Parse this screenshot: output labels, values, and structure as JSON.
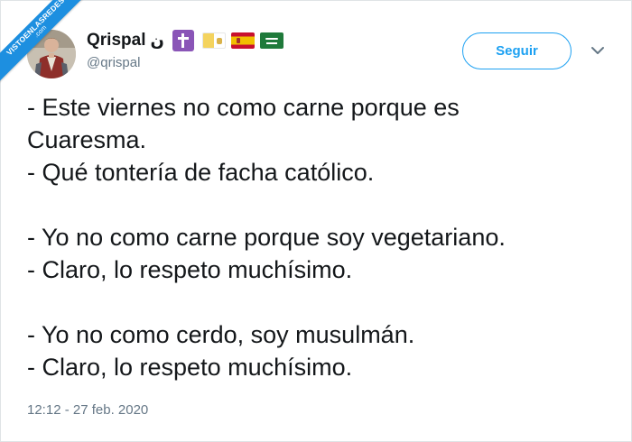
{
  "watermark": {
    "line1": "VISTOENLASREDES",
    "line2": ".com"
  },
  "author": {
    "display_name": "Qrispal",
    "name_glyph": "ن",
    "emoji": [
      "latin-cross-emoji",
      "vatican-flag-emoji",
      "spain-flag-emoji",
      "saudi-arabia-flag-emoji"
    ],
    "handle": "@qrispal"
  },
  "follow_button": {
    "label": "Seguir"
  },
  "tweet": {
    "lines": [
      "- Este viernes no como carne porque es",
      "Cuaresma.",
      "- Qué tontería de facha católico.",
      "",
      "- Yo no como carne porque soy vegetariano.",
      "- Claro, lo respeto muchísimo.",
      "",
      "- Yo no como cerdo, soy musulmán.",
      "- Claro, lo respeto muchísimo."
    ],
    "timestamp": "12:12 - 27 feb. 2020"
  },
  "colors": {
    "accent": "#1da1f2",
    "text_primary": "#14171a",
    "text_secondary": "#657786",
    "ribbon": "#1d8fe0"
  }
}
